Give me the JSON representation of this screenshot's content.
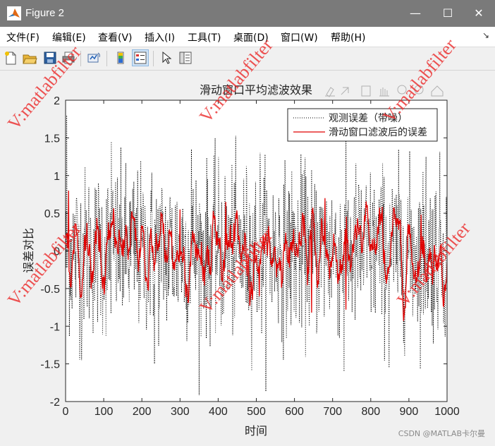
{
  "window": {
    "title": "Figure 2",
    "minimize_glyph": "—",
    "maximize_glyph": "☐",
    "close_glyph": "✕"
  },
  "menu": [
    "文件(F)",
    "编辑(E)",
    "查看(V)",
    "插入(I)",
    "工具(T)",
    "桌面(D)",
    "窗口(W)",
    "帮助(H)"
  ],
  "toolbar": [
    "new-figure-icon",
    "open-file-icon",
    "save-icon",
    "print-icon",
    "link-plot-icon",
    "colorbar-icon",
    "legend-icon",
    "pointer-icon",
    "property-inspector-icon"
  ],
  "axes_toolbar": [
    "brush-icon",
    "datatip-icon",
    "pan-icon",
    "zoom-in-icon",
    "zoom-out-icon",
    "home-icon"
  ],
  "chart_data": {
    "type": "line",
    "title": "滑动窗口平均滤波效果",
    "xlabel": "时间",
    "ylabel": "误差对比",
    "xlim": [
      0,
      1000
    ],
    "ylim": [
      -2,
      2
    ],
    "xticks": [
      "0",
      "100",
      "200",
      "300",
      "400",
      "500",
      "600",
      "700",
      "800",
      "900",
      "1000"
    ],
    "yticks": [
      "2",
      "1.5",
      "1",
      "0.5",
      "0",
      "-0.5",
      "-1",
      "-1.5",
      "-2"
    ],
    "legend_position": "top-right",
    "series": [
      {
        "name": "观测误差（带噪）",
        "color": "#000000",
        "style": "dotted",
        "peaks": [
          [
            3,
            1.8
          ],
          [
            42,
            -1.45
          ],
          [
            120,
            1.45
          ],
          [
            233,
            -1.5
          ],
          [
            330,
            1.35
          ],
          [
            510,
            1.3
          ],
          [
            730,
            -1.6
          ],
          [
            848,
            -1.55
          ],
          [
            945,
            1.25
          ]
        ]
      },
      {
        "name": "滑动窗口滤波后的误差",
        "color": "#e00000",
        "style": "solid",
        "peaks": [
          [
            8,
            0.8
          ],
          [
            300,
            0.55
          ],
          [
            420,
            0.65
          ],
          [
            508,
            -0.6
          ],
          [
            645,
            -0.82
          ],
          [
            680,
            0.7
          ],
          [
            735,
            -0.78
          ],
          [
            932,
            0.48
          ]
        ]
      }
    ]
  },
  "watermark": "V:matlabfilter",
  "credit": "CSDN @MATLAB卡尔曼"
}
